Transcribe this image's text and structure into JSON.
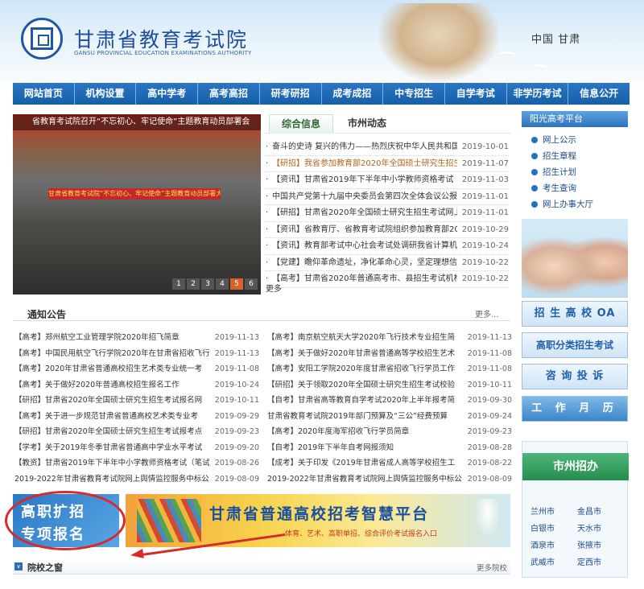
{
  "header": {
    "title": "甘肃省教育考试院",
    "subtitle": "GANSU PROVINCIAL EDUCATION EXAMINATIONS AUTHORITY",
    "region": "中国  甘肃"
  },
  "nav": [
    "网站首页",
    "机构设置",
    "高中学考",
    "高考高招",
    "研考研招",
    "成考成招",
    "中专招生",
    "自学考试",
    "非学历考试",
    "信息公开"
  ],
  "slideshow": {
    "caption": "省教育考试院召开“不忘初心、牢记使命”主题教育动员部署会",
    "banner": "甘肃省教育考试院“不忘初心、牢记使命”主题教育动员部署大会",
    "pages": [
      "1",
      "2",
      "3",
      "4",
      "5",
      "6"
    ]
  },
  "news": {
    "tabs": [
      "综合信息",
      "市州动态"
    ],
    "items": [
      {
        "title": "奋斗的史诗 复兴的伟力——热烈庆祝中华人民共和国",
        "date": "2019-10-01",
        "highlight": false
      },
      {
        "title": "【研招】我省参加教育部2020年全国硕士研究生招生",
        "date": "2019-11-07",
        "highlight": true
      },
      {
        "title": "【资讯】甘肃省2019年下半年中小学教师资格考试（笔",
        "date": "2019-11-03",
        "highlight": false
      },
      {
        "title": "中国共产党第十九届中央委员会第四次全体会议公报",
        "date": "2019-11-01",
        "highlight": false
      },
      {
        "title": "【研招】甘肃省2020年全国硕士研究生招生考试网上",
        "date": "2019-11-01",
        "highlight": false
      },
      {
        "title": "【资讯】省教育厅、省教育考试院组织参加教育部20",
        "date": "2019-10-29",
        "highlight": false
      },
      {
        "title": "【资讯】教育部考试中心社会考试处调研我省计算机",
        "date": "2019-10-24",
        "highlight": false
      },
      {
        "title": "【党建】瞻仰革命遗址，净化革命心灵，坚定理想信念",
        "date": "2019-10-22",
        "highlight": false
      },
      {
        "title": "【高考】甘肃省2020年普通高考市、县招生考试机构",
        "date": "2019-10-22",
        "highlight": false
      }
    ],
    "more": "更多"
  },
  "sidebar": {
    "platform_title": "阳光高考平台",
    "links": [
      "网上公示",
      "招生章程",
      "招生计划",
      "考生查询",
      "网上办事大厅"
    ],
    "oa": "招 生 高 校 OA",
    "vocational": "高职分类招生考试",
    "inquiry": "咨 询 投 诉",
    "workmonth": "工 作 月 历",
    "city_title": "市州招办",
    "cities": [
      "兰州市",
      "金昌市",
      "白银市",
      "天水市",
      "酒泉市",
      "张掖市",
      "武威市",
      "定西市"
    ]
  },
  "notices": {
    "title": "通知公告",
    "more": "更多...",
    "left": [
      {
        "title": "【高考】郑州航空工业管理学院2020年招飞简章",
        "date": "2019-11-13"
      },
      {
        "title": "【高考】中国民用航空飞行学院2020年在甘肃省招收飞行",
        "date": "2019-11-13"
      },
      {
        "title": "【高考】2020年甘肃省普通高校招生艺术类专业统一考",
        "date": "2019-11-08"
      },
      {
        "title": "【高考】关于做好2020年普通高校招生报名工作",
        "date": "2019-10-24"
      },
      {
        "title": "【研招】甘肃省2020年全国硕士研究生招生考试报名网",
        "date": "2019-10-11"
      },
      {
        "title": "【高考】关于进一步规范甘肃省普通高校艺术类专业考",
        "date": "2019-09-29"
      },
      {
        "title": "【研招】甘肃省2020年全国硕士研究生招生考试报考点",
        "date": "2019-09-23"
      },
      {
        "title": "【学考】关于2019年冬季甘肃省普通高中学业水平考试",
        "date": "2019-09-20"
      },
      {
        "title": "【教资】甘肃省2019年下半年中小学教师资格考试（笔试",
        "date": "2019-08-26"
      },
      {
        "title": "2019-2022年甘肃省教育考试院网上舆情监控服务中标公",
        "date": "2019-08-09"
      }
    ],
    "right": [
      {
        "title": "【高考】南京航空航天大学2020年飞行技术专业招生简",
        "date": "2019-11-13"
      },
      {
        "title": "【高考】关于做好2020年甘肃省普通高等学校招生艺术",
        "date": "2019-11-08"
      },
      {
        "title": "【高考】安阳工学院2020年度甘肃省招收飞行学员工作",
        "date": "2019-11-08"
      },
      {
        "title": "【研招】关于领取2020年全国硕士研究生招生考试校验",
        "date": "2019-10-11"
      },
      {
        "title": "【自考】甘肃省高等教育自学考试2020年上半年报考简",
        "date": "2019-09-30"
      },
      {
        "title": "甘肃省教育考试院2019年部门预算及“三公”经费预算",
        "date": "2019-09-24"
      },
      {
        "title": "【高考】2020年度海军招收飞行学员简章",
        "date": "2019-09-23"
      },
      {
        "title": "【自考】2019年下半年自考网报须知",
        "date": "2019-08-28"
      },
      {
        "title": "【成考】关于印发《2019年甘肃省成人高等学校招生工",
        "date": "2019-08-22"
      },
      {
        "title": "2019-2022年甘肃省教育考试院网上舆情监控服务中标公",
        "date": "2019-08-09"
      }
    ]
  },
  "banners": {
    "special_line1": "高职扩招",
    "special_line2": "专项报名",
    "smart_title": "甘肃省普通高校招考智慧平台",
    "smart_sub": "体育、艺术、高职单招、综合评价考试报名入口"
  },
  "schools": {
    "title": "院校之窗",
    "icon": "∨",
    "more": "更多院校"
  },
  "colors": {
    "nav_blue": "#1f68b5",
    "title_blue": "#1f4f9c",
    "annotation_red": "#d92a2a",
    "city_green": "#248e4d"
  }
}
